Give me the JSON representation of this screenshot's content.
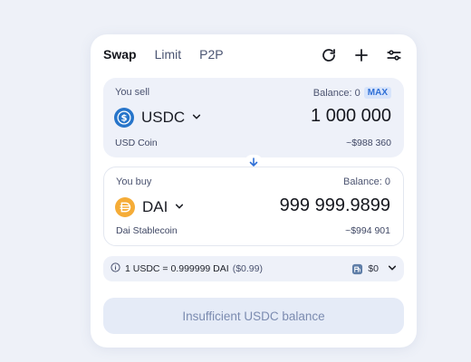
{
  "tabs": [
    {
      "label": "Swap",
      "active": true
    },
    {
      "label": "Limit",
      "active": false
    },
    {
      "label": "P2P",
      "active": false
    }
  ],
  "toolbar": {
    "refresh_icon": "refresh-icon",
    "add_icon": "plus-icon",
    "settings_icon": "sliders-icon"
  },
  "sell": {
    "label": "You sell",
    "balance": "Balance: 0",
    "max_label": "MAX",
    "token_symbol": "USDC",
    "token_name": "USD Coin",
    "amount": "1 000 000",
    "fiat": "~$988 360",
    "logo_color": "#2775ca"
  },
  "buy": {
    "label": "You buy",
    "balance": "Balance: 0",
    "token_symbol": "DAI",
    "token_name": "Dai Stablecoin",
    "amount": "999 999.9899",
    "fiat": "~$994 901",
    "logo_color": "#f5ac37"
  },
  "rate": {
    "text": "1 USDC = 0.999999 DAI",
    "fiat": "($0.99)",
    "gas": "$0"
  },
  "cta": {
    "label": "Insufficient USDC balance"
  },
  "colors": {
    "background": "#eef1f8",
    "panel": "#eef1f9",
    "accent": "#2f6fd6",
    "cta_bg": "#e5ebf7",
    "cta_text": "#7b8bb0"
  }
}
